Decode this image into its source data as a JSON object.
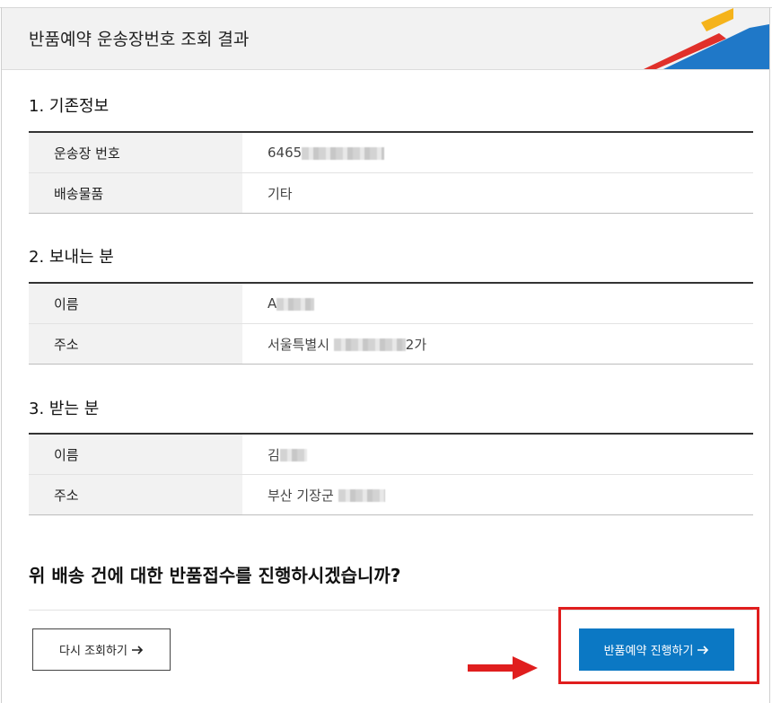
{
  "header": {
    "title": "반품예약 운송장번호 조회 결과"
  },
  "sections": [
    {
      "title": "1. 기존정보",
      "rows": [
        {
          "label": "운송장 번호",
          "value_prefix": "6465",
          "value_suffix": ""
        },
        {
          "label": "배송물품",
          "value_prefix": "기타",
          "value_suffix": ""
        }
      ]
    },
    {
      "title": "2. 보내는 분",
      "rows": [
        {
          "label": "이름",
          "value_prefix": "A",
          "value_suffix": ""
        },
        {
          "label": "주소",
          "value_prefix": "서울특별시 ",
          "value_suffix": "2가"
        }
      ]
    },
    {
      "title": "3. 받는 분",
      "rows": [
        {
          "label": "이름",
          "value_prefix": "김",
          "value_suffix": ""
        },
        {
          "label": "주소",
          "value_prefix": "부산 기장군 ",
          "value_suffix": ""
        }
      ]
    }
  ],
  "question": "위 배송 건에 대한 반품접수를 진행하시겠습니까?",
  "buttons": {
    "retry_label": "다시 조회하기",
    "submit_label": "반품예약 진행하기"
  },
  "colors": {
    "primary_button": "#0b78c4",
    "highlight": "#e01e1e",
    "deco_yellow": "#f5b31b",
    "deco_blue": "#1f78c8",
    "deco_red": "#e0302a"
  }
}
